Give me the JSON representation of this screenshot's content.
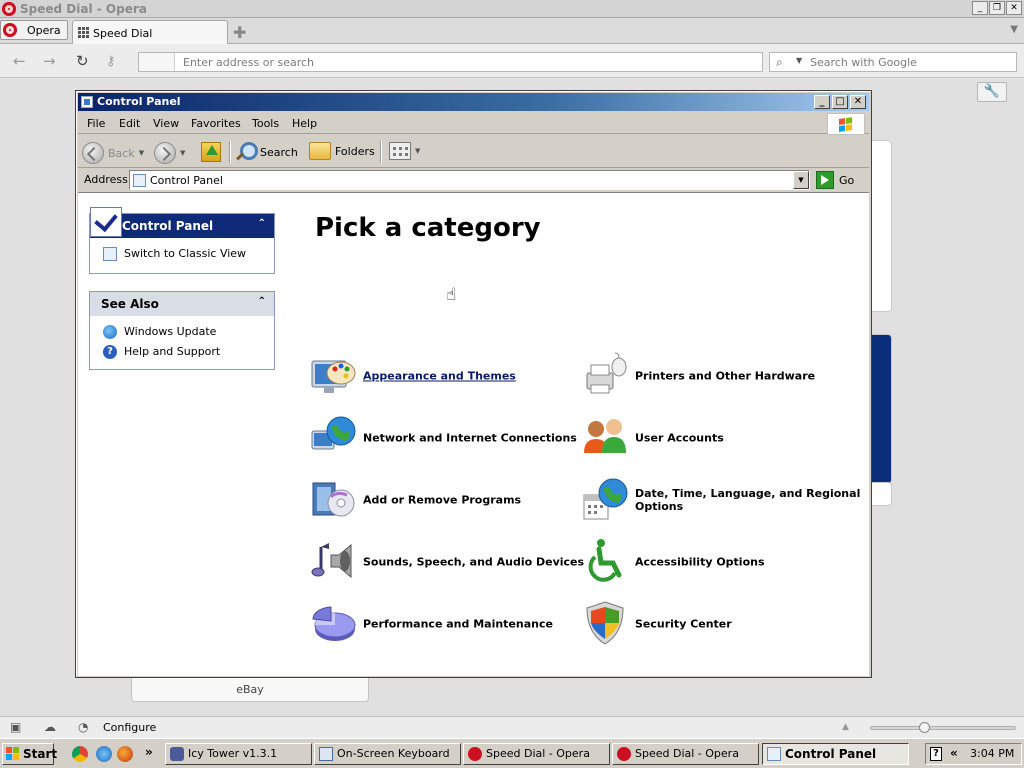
{
  "opera": {
    "window_title": "Speed Dial - Opera",
    "window_controls": [
      "_",
      "❐",
      "✕"
    ],
    "menu_button_label": "Opera",
    "active_tab_label": "Speed Dial",
    "address_placeholder": "Enter address or search",
    "search_placeholder": "Search with Google",
    "speed_dial_ebay_label": "eBay",
    "status_configure_label": "Configure",
    "zoom_level": 0.37
  },
  "control_panel": {
    "window_title": "Control Panel",
    "window_controls": [
      "_",
      "□",
      "✕"
    ],
    "menu": [
      "File",
      "Edit",
      "View",
      "Favorites",
      "Tools",
      "Help"
    ],
    "toolbar": {
      "back_label": "Back",
      "search_label": "Search",
      "folders_label": "Folders"
    },
    "address_label": "Address",
    "address_value": "Control Panel",
    "go_label": "Go",
    "sidebar": {
      "control_panel_title": "Control Panel",
      "switch_label": "Switch to Classic View",
      "see_also_title": "See Also",
      "see_also_items": [
        "Windows Update",
        "Help and Support"
      ],
      "collapse_glyph": "⌃"
    },
    "heading": "Pick a category",
    "categories": [
      {
        "label": "Appearance and Themes",
        "icon": "appearance-themes-icon",
        "hovered": true
      },
      {
        "label": "Printers and Other Hardware",
        "icon": "printer-icon"
      },
      {
        "label": "Network and Internet Connections",
        "icon": "network-globe-icon"
      },
      {
        "label": "User Accounts",
        "icon": "user-accounts-icon"
      },
      {
        "label": "Add or Remove Programs",
        "icon": "add-remove-programs-icon"
      },
      {
        "label": "Date, Time, Language, and Regional Options",
        "icon": "date-time-globe-icon"
      },
      {
        "label": "Sounds, Speech, and Audio Devices",
        "icon": "speaker-note-icon"
      },
      {
        "label": "Accessibility Options",
        "icon": "accessibility-icon"
      },
      {
        "label": "Performance and Maintenance",
        "icon": "pie-chart-icon"
      },
      {
        "label": "Security Center",
        "icon": "shield-icon"
      }
    ]
  },
  "taskbar": {
    "start_label": "Start",
    "more_glyph": "»",
    "buttons": [
      {
        "label": "Icy Tower v1.3.1"
      },
      {
        "label": "On-Screen Keyboard"
      },
      {
        "label": "Speed Dial - Opera"
      },
      {
        "label": "Speed Dial - Opera"
      },
      {
        "label": "Control Panel",
        "active": true
      }
    ],
    "tray_chevron": "«",
    "clock": "3:04 PM"
  },
  "colors": {
    "xp_title_start": "#0a246a",
    "xp_title_end": "#a6caf0",
    "panel_header_blue": "#0e2a78",
    "opera_red": "#cc1020",
    "category_link": "#0a1a6a"
  }
}
